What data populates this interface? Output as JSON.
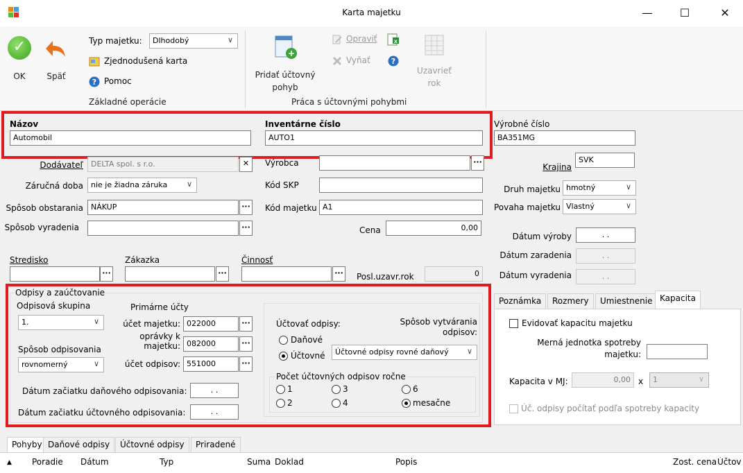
{
  "window": {
    "title": "Karta majetku",
    "minimize": "—",
    "maximize": "☐",
    "close": "✕"
  },
  "ribbon": {
    "ok_label": "OK",
    "back_label": "Späť",
    "asset_type_label": "Typ majetku:",
    "asset_type_value": "Dlhodobý",
    "simple_card_label": "Zjednodušená karta",
    "help_label": "Pomoc",
    "group1_label": "Základné operácie",
    "add_move_label_1": "Pridať účtovný",
    "add_move_label_2": "pohyb",
    "edit_label": "Opraviť",
    "remove_label": "Vyňať",
    "close_year_label_1": "Uzavrieť",
    "close_year_label_2": "rok",
    "group2_label": "Práca s účtovnými pohybmi"
  },
  "form": {
    "name_label": "Názov",
    "name_value": "Automobil",
    "inv_label": "Inventárne číslo",
    "inv_value": "AUTO1",
    "serial_label": "Výrobné číslo",
    "serial_value": "BA351MG",
    "supplier_label": "Dodávateľ",
    "supplier_value": "DELTA spol. s r.o.",
    "manufacturer_label": "Výrobca",
    "manufacturer_value": "",
    "country_label": "Krajina",
    "country_value": "SVK",
    "warranty_label": "Záručná doba",
    "warranty_value": "nie je žiadna záruka",
    "skp_label": "Kód SKP",
    "skp_value": "",
    "kind_label": "Druh majetku",
    "kind_value": "hmotný",
    "acq_label": "Spôsob obstarania",
    "acq_value": "NÁKUP",
    "code_label": "Kód majetku",
    "code_value": "A1",
    "nature_label": "Povaha majetku",
    "nature_value": "Vlastný",
    "disp_label": "Spôsob vyradenia",
    "disp_value": "",
    "price_label": "Cena",
    "price_value": "0,00",
    "prod_date_label": "Dátum výroby",
    "prod_date_value": ". .",
    "incl_date_label": "Dátum zaradenia",
    "incl_date_value": ". .",
    "disp_date_label": "Dátum vyradenia",
    "disp_date_value": ". .",
    "center_label": "Stredisko",
    "order_label": "Zákazka",
    "activity_label": "Činnosť",
    "last_closed_label": "Posl.uzavr.rok",
    "last_closed_value": "0"
  },
  "depreciation": {
    "group_label": "Odpisy a zaúčtovanie",
    "dep_group_label": "Odpisová skupina",
    "dep_group_value": "1.",
    "method_label": "Spôsob odpisovania",
    "method_value": "rovnomerný",
    "primary_label": "Primárne účty",
    "acc_asset_label": "účet majetku:",
    "acc_asset_value": "022000",
    "acc_adj_label_1": "oprávky k",
    "acc_adj_label_2": "majetku:",
    "acc_adj_value": "082000",
    "acc_dep_label": "účet odpisov:",
    "acc_dep_value": "551000",
    "tax_start_label": "Dátum začiatku daňového odpisovania:",
    "tax_start_value": ". .",
    "acc_start_label": "Dátum začiatku účtovného odpisovania:",
    "acc_start_value": ". .",
    "book_label": "Účtovať odpisy:",
    "radio_tax": "Daňové",
    "radio_acc": "Účtovné",
    "create_label_1": "Spôsob vytvárania",
    "create_label_2": "odpisov:",
    "create_value": "Účtovné odpisy rovné daňový",
    "count_label": "Počet účtovných odpisov ročne",
    "c1": "1",
    "c2": "2",
    "c3": "3",
    "c4": "4",
    "c6": "6",
    "cm": "mesačne"
  },
  "right_tabs": {
    "t1": "Poznámka",
    "t2": "Rozmery",
    "t3": "Umiestnenie",
    "t4": "Kapacita"
  },
  "capacity": {
    "track_label": "Evidovať kapacitu majetku",
    "unit_label_1": "Merná jednotka spotreby",
    "unit_label_2": "majetku:",
    "cap_label": "Kapacita v MJ:",
    "cap_value": "0,00",
    "times": "x",
    "cap_combo": "1",
    "calc_label": "Úč. odpisy počítať podľa spotreby kapacity"
  },
  "bottom_tabs": {
    "t1": "Pohyby",
    "t2": "Daňové odpisy",
    "t3": "Účtovné odpisy",
    "t4": "Priradené"
  },
  "grid": {
    "c0": "▲",
    "c1": "Poradie",
    "c2": "Dátum",
    "c3": "Typ",
    "c4": "Suma",
    "c5": "Doklad",
    "c6": "Popis",
    "c7": "Zost. cena",
    "c8": "Účtov"
  }
}
